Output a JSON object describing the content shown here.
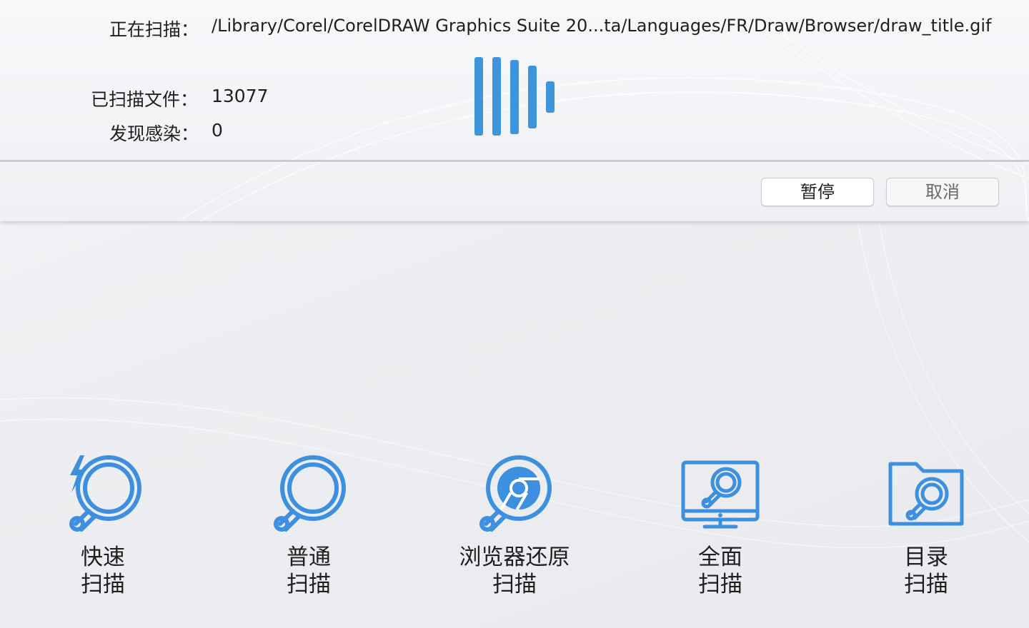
{
  "scan_status": {
    "scanning_label": "正在扫描：",
    "current_path": "/Library/Corel/CorelDRAW Graphics Suite 20...ta/Languages/FR/Draw/Browser/draw_title.gif",
    "scanned_files_label": "已扫描文件：",
    "scanned_files_count": "13077",
    "infections_label": "发现感染：",
    "infections_count": "0"
  },
  "buttons": {
    "pause": "暂停",
    "cancel": "取消"
  },
  "scan_modes": [
    {
      "line1": "快速",
      "line2": "扫描",
      "icon": "quick-scan-icon"
    },
    {
      "line1": "普通",
      "line2": "扫描",
      "icon": "normal-scan-icon"
    },
    {
      "line1": "浏览器还原",
      "line2": "扫描",
      "icon": "browser-scan-icon"
    },
    {
      "line1": "全面",
      "line2": "扫描",
      "icon": "full-scan-icon"
    },
    {
      "line1": "目录",
      "line2": "扫描",
      "icon": "folder-scan-icon"
    }
  ],
  "colors": {
    "accent": "#3e95dc",
    "icon_stroke": "#3d8fe0"
  }
}
